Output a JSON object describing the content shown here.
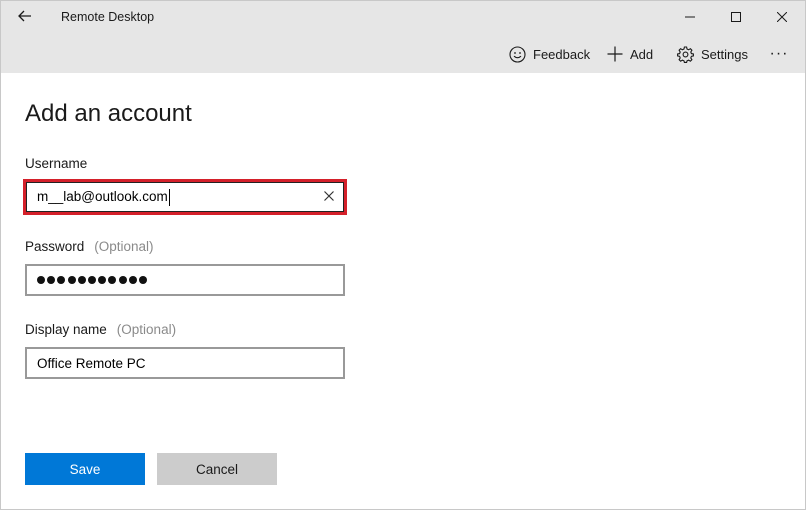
{
  "window": {
    "title": "Remote Desktop",
    "back_icon": "back-arrow-icon",
    "controls": [
      "minimize-icon",
      "maximize-icon",
      "close-icon"
    ]
  },
  "commandbar": {
    "feedback": {
      "label": "Feedback",
      "icon": "smiley-icon"
    },
    "add": {
      "label": "Add",
      "icon": "plus-icon"
    },
    "settings": {
      "label": "Settings",
      "icon": "gear-icon"
    },
    "more": {
      "label": "···",
      "icon": "more-icon"
    }
  },
  "page": {
    "title": "Add an account"
  },
  "form": {
    "username": {
      "label": "Username",
      "value": "m__lab@outlook.com"
    },
    "password": {
      "label": "Password",
      "optional": "(Optional)",
      "masked_length": 11
    },
    "display_name": {
      "label": "Display name",
      "optional": "(Optional)",
      "value": "Office Remote PC"
    }
  },
  "actions": {
    "save": "Save",
    "cancel": "Cancel"
  },
  "colors": {
    "accent": "#0078d7",
    "focus_highlight": "#d4202a",
    "chrome": "#e6e6e6",
    "secondary_button": "#cccccc",
    "optional_text": "#8a8a8a"
  }
}
